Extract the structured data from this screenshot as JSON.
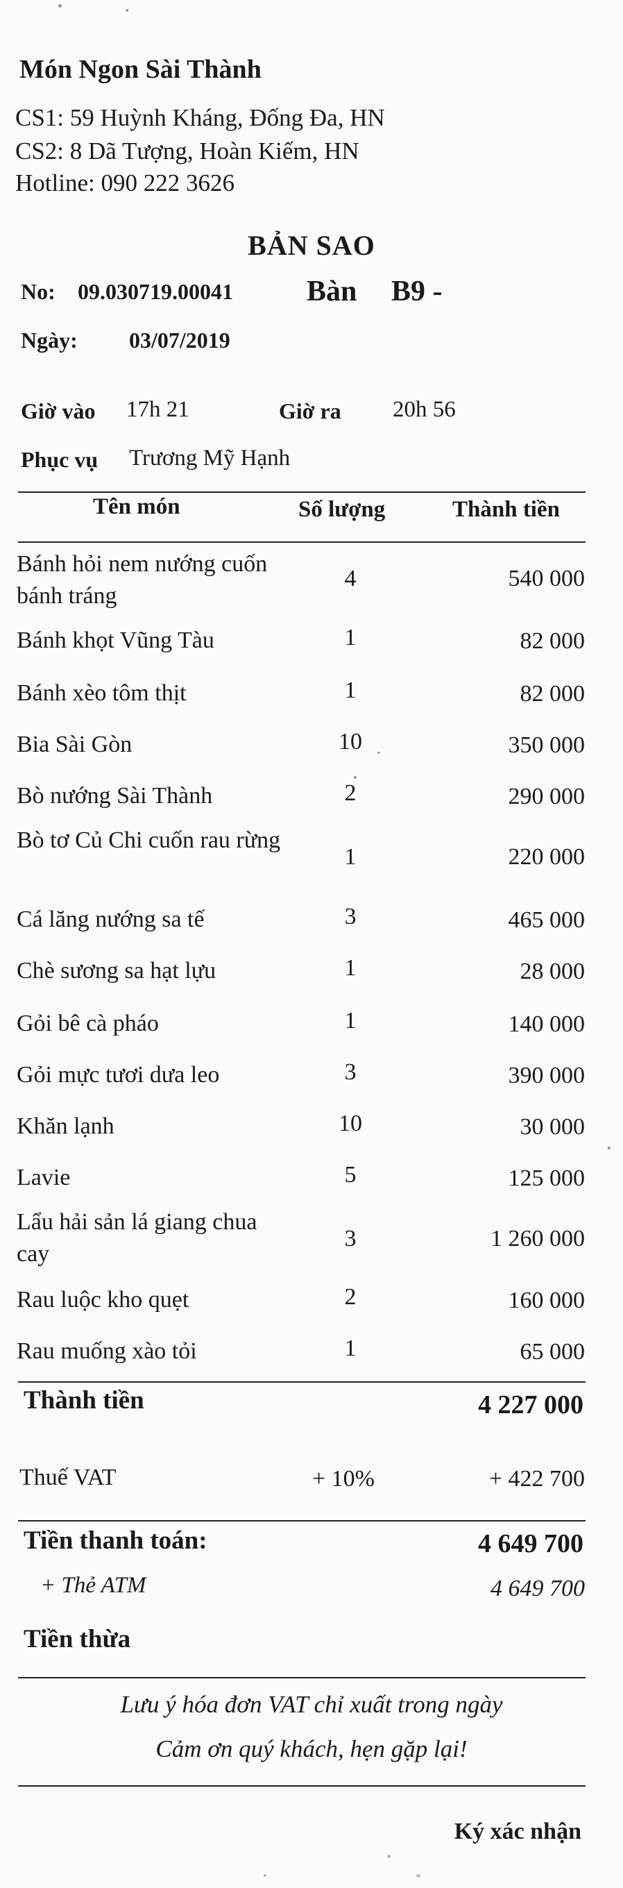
{
  "shop": {
    "name": "Món Ngon Sài Thành",
    "address1": "CS1: 59 Huỳnh Kháng, Đống Đa, HN",
    "address2": "CS2: 8 Dã Tượng, Hoàn Kiếm, HN",
    "hotline": "Hotline: 090 222 3626"
  },
  "doc_title": "BẢN SAO",
  "meta": {
    "no_label": "No:",
    "no_value": "09.030719.00041",
    "table_label": "Bàn",
    "table_value": "B9 -",
    "date_label": "Ngày:",
    "date_value": "03/07/2019",
    "in_label": "Giờ vào",
    "in_value": "17h 21",
    "out_label": "Giờ ra",
    "out_value": "20h 56",
    "server_label": "Phục vụ",
    "server_value": "Trương Mỹ Hạnh"
  },
  "columns": {
    "name": "Tên món",
    "qty": "Số lượng",
    "amount": "Thành tiền"
  },
  "items": [
    {
      "name": "Bánh hỏi nem nướng cuốn bánh tráng",
      "qty": "4",
      "amount": "540 000"
    },
    {
      "name": "Bánh khọt Vũng Tàu",
      "qty": "1",
      "amount": "82 000"
    },
    {
      "name": "Bánh xèo tôm thịt",
      "qty": "1",
      "amount": "82 000"
    },
    {
      "name": "Bia Sài Gòn",
      "qty": "10",
      "amount": "350 000"
    },
    {
      "name": "Bò nướng Sài Thành",
      "qty": "2",
      "amount": "290 000"
    },
    {
      "name": "Bò tơ Củ Chi cuốn rau rừng",
      "qty": "1",
      "amount": "220 000"
    },
    {
      "name": "Cá lăng nướng sa tế",
      "qty": "3",
      "amount": "465 000"
    },
    {
      "name": "Chè sương sa hạt lựu",
      "qty": "1",
      "amount": "28 000"
    },
    {
      "name": "Gỏi bê cà pháo",
      "qty": "1",
      "amount": "140 000"
    },
    {
      "name": "Gỏi mực tươi dưa leo",
      "qty": "3",
      "amount": "390 000"
    },
    {
      "name": "Khăn lạnh",
      "qty": "10",
      "amount": "30 000"
    },
    {
      "name": "Lavie",
      "qty": "5",
      "amount": "125 000"
    },
    {
      "name": "Lẩu hải sản lá giang chua cay",
      "qty": "3",
      "amount": "1 260 000"
    },
    {
      "name": "Rau luộc kho quẹt",
      "qty": "2",
      "amount": "160 000"
    },
    {
      "name": "Rau muống xào tỏi",
      "qty": "1",
      "amount": "65 000"
    }
  ],
  "totals": {
    "subtotal_label": "Thành tiền",
    "subtotal_value": "4 227 000",
    "vat_label": "Thuế VAT",
    "vat_rate": "+ 10%",
    "vat_value": "+ 422 700",
    "pay_label": "Tiền thanh toán:",
    "pay_value": "4 649 700",
    "method_label": "+ Thẻ ATM",
    "method_value": "4 649 700",
    "change_label": "Tiền thừa"
  },
  "footer": {
    "note1": "Lưu ý hóa đơn VAT chỉ xuất trong ngày",
    "note2": "Cảm ơn quý khách, hẹn gặp lại!",
    "sign": "Ký xác nhận"
  }
}
